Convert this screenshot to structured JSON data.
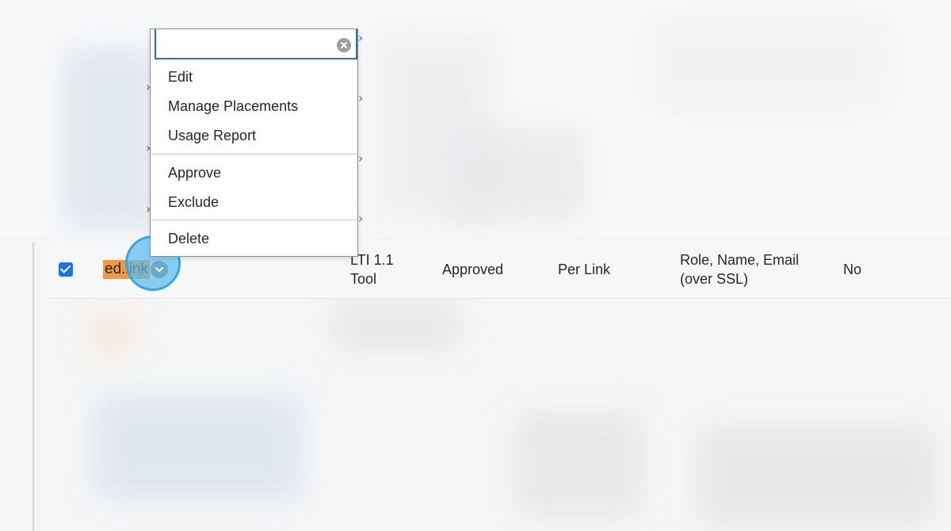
{
  "menu": {
    "search": {
      "value": "",
      "placeholder": ""
    },
    "items_group1": [
      "Edit",
      "Manage Placements",
      "Usage Report"
    ],
    "items_group2": [
      "Approve",
      "Exclude"
    ],
    "items_group3": [
      "Delete"
    ]
  },
  "row": {
    "checked": true,
    "tool_name": "ed.link",
    "type": "LTI 1.1 Tool",
    "status": "Approved",
    "privacy": "Per Link",
    "data_shared": "Role, Name, Email (over SSL)",
    "flag": "No"
  },
  "icons": {
    "clear": "clear-circle-icon",
    "chevron": "chevron-down-icon",
    "check": "check-icon"
  },
  "colors": {
    "highlight": "#5cbdf0",
    "tool_badge": "#ee9a47",
    "checkbox": "#1a73e8",
    "search_border": "#2f6f9f"
  }
}
